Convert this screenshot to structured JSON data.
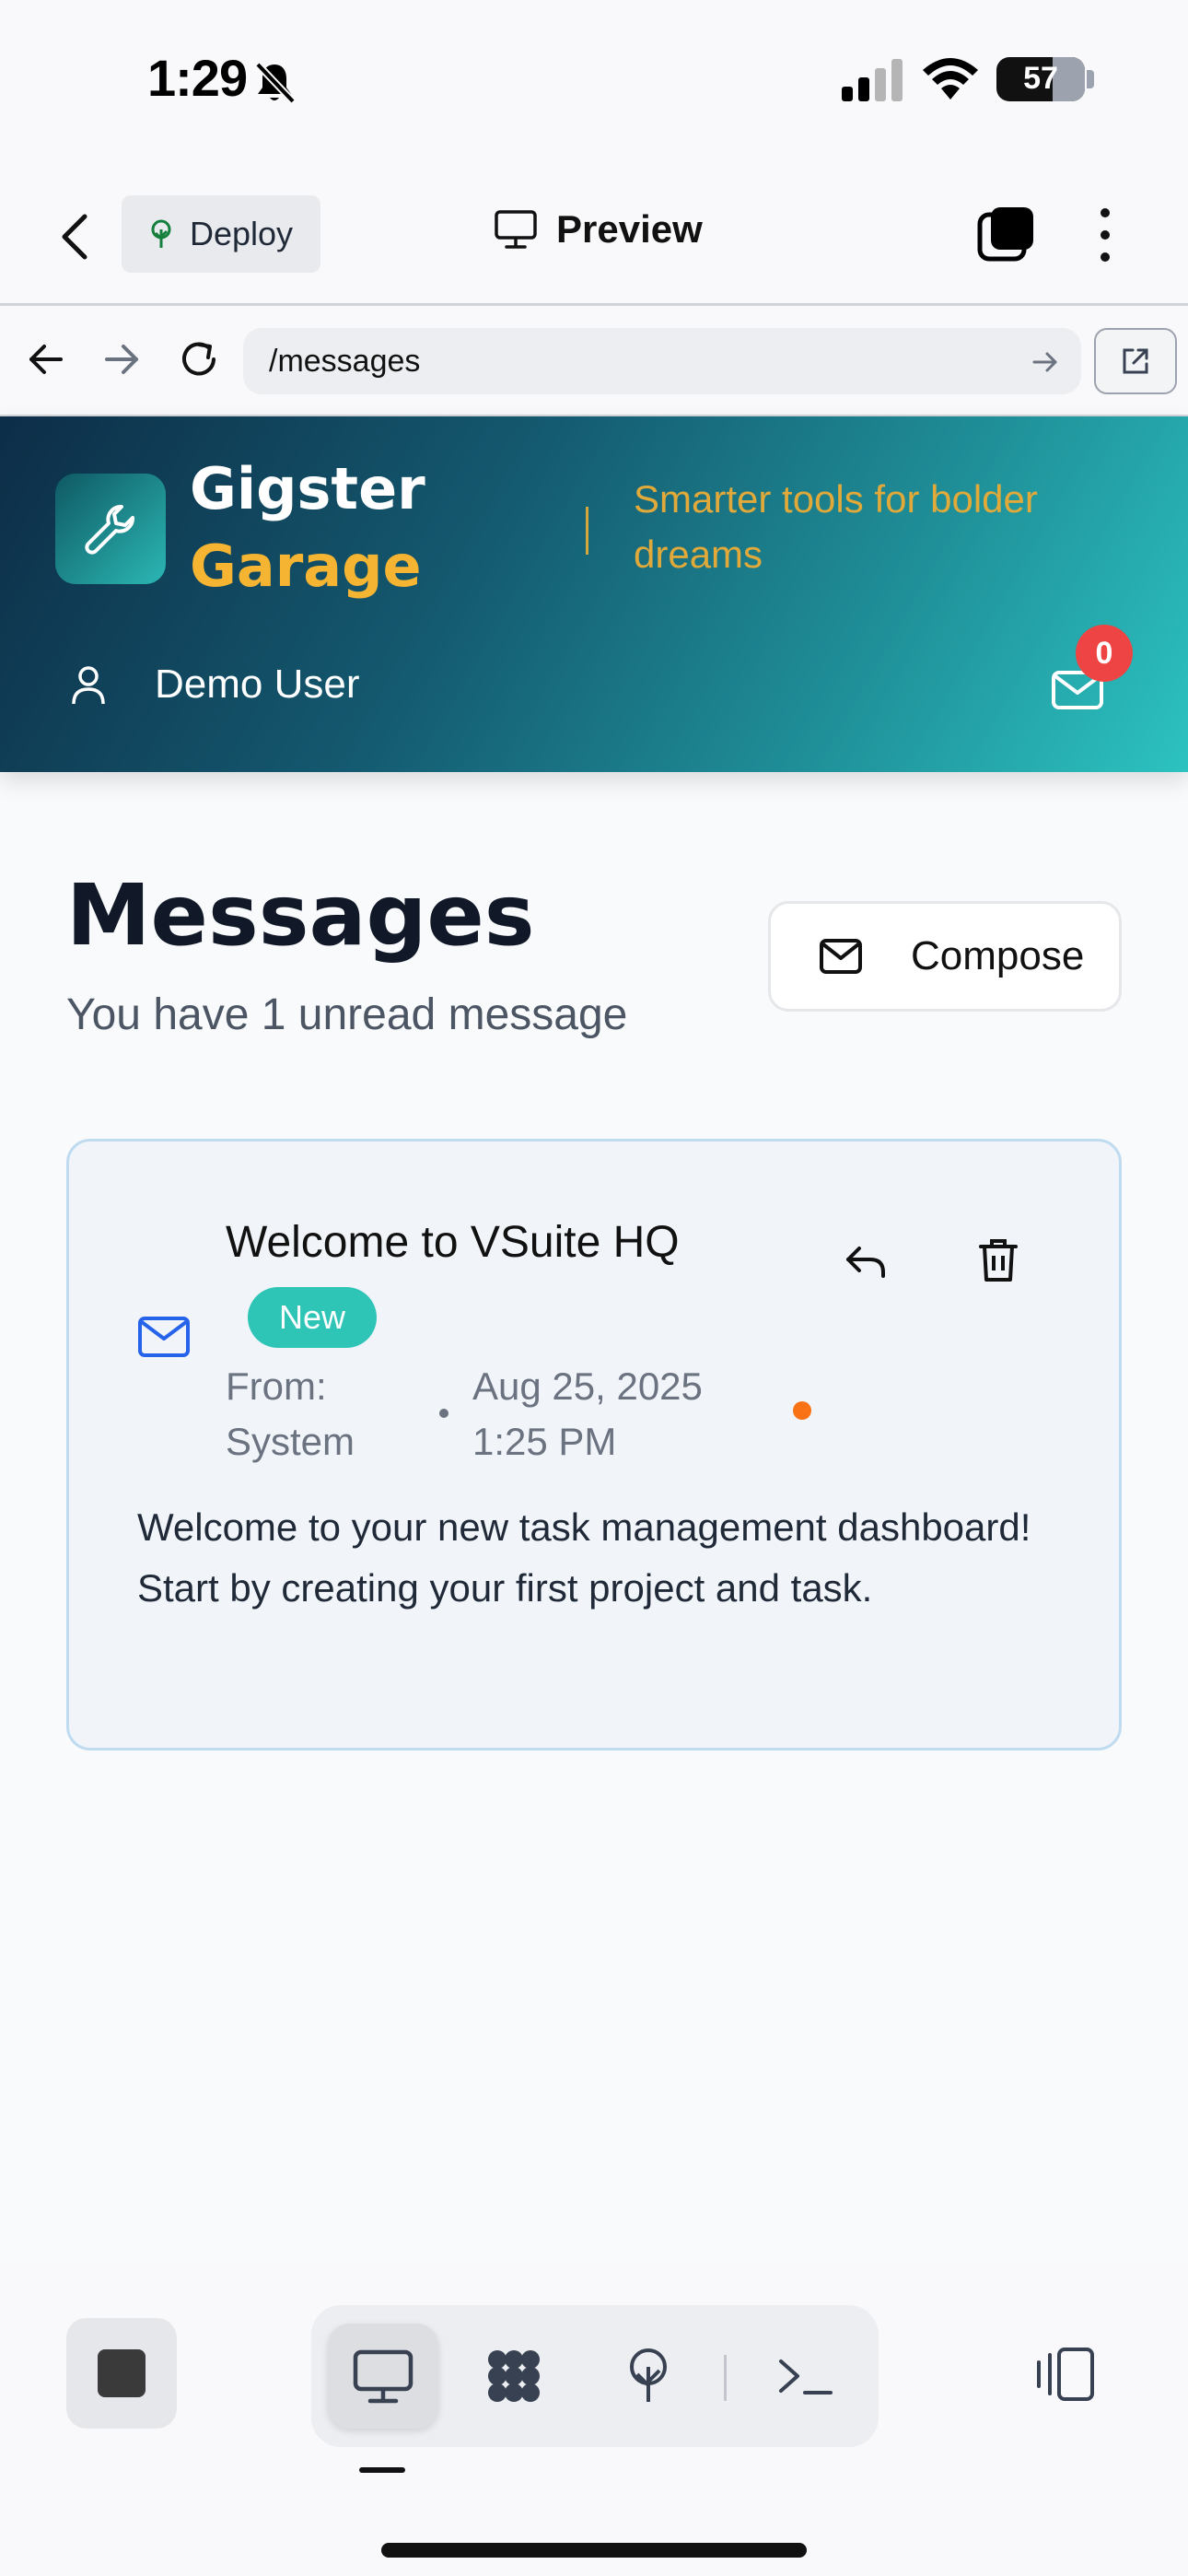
{
  "status_bar": {
    "time": "1:29",
    "battery": "57"
  },
  "app_bar": {
    "deploy_label": "Deploy",
    "preview_label": "Preview"
  },
  "url_bar": {
    "url": "/messages"
  },
  "header": {
    "brand_line1": "Gigster",
    "brand_line2": "Garage",
    "tagline": "Smarter tools for bolder dreams",
    "user_name": "Demo User",
    "mail_badge_count": "0"
  },
  "page": {
    "title": "Messages",
    "subtitle": "You have 1 unread message",
    "compose_label": "Compose"
  },
  "messages": [
    {
      "title": "Welcome to VSuite HQ",
      "badge": "New",
      "from": "From: System",
      "date": "Aug 25, 2025 1:25 PM",
      "body": "Welcome to your new task management dashboard! Start by creating your first project and task."
    }
  ],
  "colors": {
    "brand_accent": "#f5b532",
    "badge_teal": "#2ec4b6",
    "unread_dot": "#f97316",
    "notification_red": "#ef4444",
    "mail_icon_blue": "#2563eb"
  },
  "icons": [
    "chevron-left-icon",
    "tree-icon",
    "monitor-icon",
    "tabs-icon",
    "kebab-icon",
    "arrow-left-icon",
    "arrow-right-icon",
    "reload-icon",
    "external-link-icon",
    "wrench-icon",
    "user-icon",
    "mail-icon",
    "reply-icon",
    "trash-icon",
    "stop-icon",
    "grid-icon",
    "terminal-icon",
    "panels-icon"
  ]
}
